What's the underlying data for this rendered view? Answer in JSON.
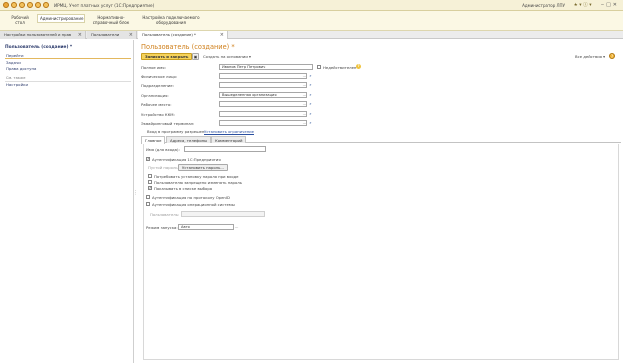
{
  "window": {
    "title": "ИРМЦ. Учет платных услуг  (1С:Предприятие)",
    "user": "Администратор ЛПУ"
  },
  "sections": [
    {
      "label": "Рабочий стол"
    },
    {
      "label": "Администрирование"
    },
    {
      "label": "Нормативно-справочный блок"
    },
    {
      "label": "Настройка подключаемого оборудования"
    }
  ],
  "open_windows": [
    {
      "label": "Настройки пользователей и прав"
    },
    {
      "label": "Пользователи"
    },
    {
      "label": "Пользователь (создание) *"
    }
  ],
  "left_panel": {
    "title": "Пользователь (создание) *",
    "go_to_label": "Перейти",
    "items": [
      "Задачи",
      "Права доступа"
    ],
    "see_also_label": "См. также",
    "see_also_items": [
      "Настройки"
    ]
  },
  "form": {
    "title": "Пользователь (создание) *",
    "save_close": "Записать и закрыть",
    "create_based": "Создать на основании",
    "all_actions": "Все действия",
    "fields": {
      "full_name_label": "Полное имя:",
      "full_name_value": "Иванов Петр Петрович",
      "person_label": "Физическое лицо:",
      "department_label": "Подразделение:",
      "organization_label": "Организация:",
      "organization_value": "Вышеделенная организация",
      "workplace_label": "Рабочее место:",
      "kkm_label": "Устройство ККМ:",
      "acquiring_label": "Эквайринговый терминал:"
    },
    "invalid_label": "Недействителен",
    "login_allowed": "Вход в программу разрешен",
    "set_restriction": "Установить ограничение",
    "tabs": [
      "Главное",
      "Адреса, телефоны",
      "Комментарий"
    ],
    "main_tab": {
      "login_name_label": "Имя (для входа):",
      "auth_1c_label": "Аутентификация 1С:Предприятия",
      "empty_password_label": "Пустой пароль",
      "set_password_button": "Установить пароль...",
      "require_password_change": "Потребовать установку пароля при входе",
      "forbid_password_change": "Пользователю запрещено изменять пароль",
      "show_in_list": "Показывать в списке выбора",
      "auth_openid": "Аутентификация по протоколу OpenID",
      "auth_os": "Аутентификация операционной системы",
      "os_user_label": "Пользователь:",
      "launch_mode_label": "Режим запуска:",
      "launch_mode_value": "Авто"
    }
  }
}
